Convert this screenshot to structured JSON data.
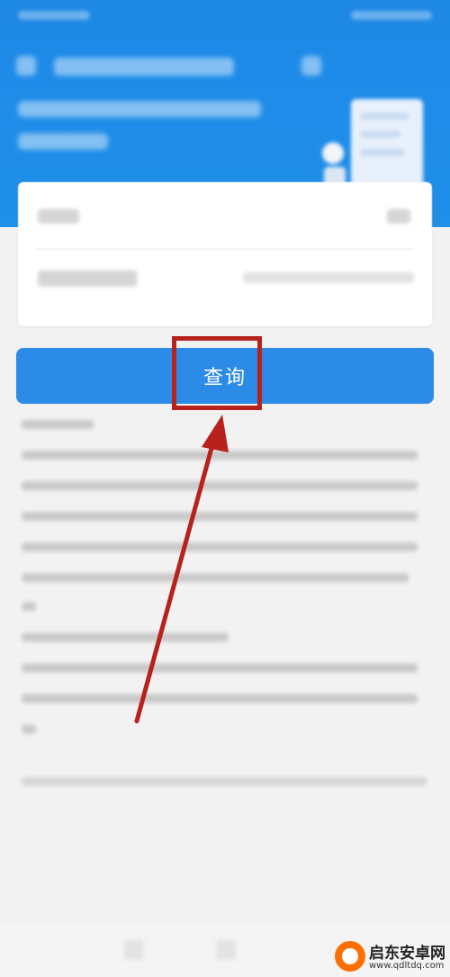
{
  "query_button": {
    "label": "查询"
  },
  "watermark": {
    "title": "启东安卓网",
    "url": "www.qdltdq.com"
  },
  "colors": {
    "header_blue": "#1e88e5",
    "button_blue": "#2d8be8",
    "annotation_red": "#b8221d",
    "watermark_orange": "#ff6f00"
  }
}
